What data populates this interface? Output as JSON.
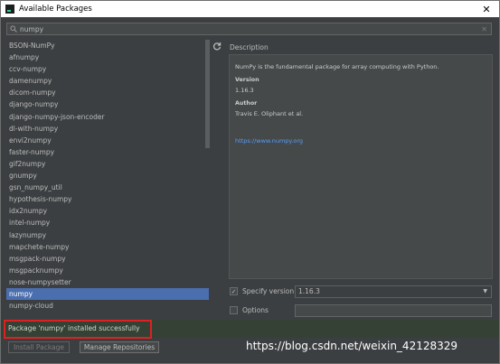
{
  "window": {
    "title": "Available Packages",
    "close_glyph": "✕"
  },
  "search": {
    "value": "numpy",
    "icon": "search-icon",
    "clear_glyph": "✕"
  },
  "packages": [
    "BSON-NumPy",
    "afnumpy",
    "ccv-numpy",
    "damenumpy",
    "dicom-numpy",
    "django-numpy",
    "django-numpy-json-encoder",
    "dl-with-numpy",
    "envi2numpy",
    "faster-numpy",
    "gif2numpy",
    "gnumpy",
    "gsn_numpy_util",
    "hypothesis-numpy",
    "idx2numpy",
    "intel-numpy",
    "lazynumpy",
    "mapchete-numpy",
    "msgpack-numpy",
    "msgpacknumpy",
    "nose-numpysetter",
    "numpy",
    "numpy-cloud"
  ],
  "selected_package": "numpy",
  "description": {
    "label": "Description",
    "summary": "NumPy is the fundamental package for array computing with Python.",
    "version_heading": "Version",
    "version": "1.16.3",
    "author_heading": "Author",
    "author": "Travis E. Oliphant et al.",
    "link": "https://www.numpy.org"
  },
  "specify_version": {
    "label": "Specify version",
    "checked": true,
    "value": "1.16.3"
  },
  "options": {
    "label": "Options",
    "checked": false,
    "value": ""
  },
  "status": {
    "message": "Package 'numpy' installed successfully"
  },
  "buttons": {
    "install": "Install Package",
    "manage": "Manage Repositories"
  },
  "watermark": "https://blog.csdn.net/weixin_42128329",
  "colors": {
    "selection": "#4b6eaf",
    "link": "#589df6",
    "status_bg": "#344134",
    "highlight": "#e02020"
  }
}
